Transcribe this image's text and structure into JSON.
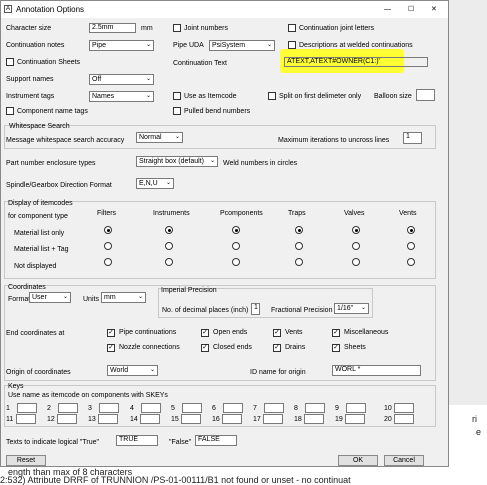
{
  "window": {
    "title": "Annotation Options",
    "minimize": "—",
    "maximize": "☐",
    "close": "✕"
  },
  "fields": {
    "character_size_label": "Character size",
    "character_size_value": "2.5mm",
    "character_size_unit": "mm",
    "joint_numbers": "Joint numbers",
    "continuation_joint_letters": "Continuation joint letters",
    "continuation_notes_label": "Continuation notes",
    "continuation_notes_value": "Pipe",
    "pipe_uda_label": "Pipe UDA",
    "pipe_uda_value": "PsiSystem",
    "descriptions_welded": "Descriptions at welded continuations",
    "continuation_sheets": "Continuation Sheets",
    "continuation_text_label": "Continuation Text",
    "continuation_text_value": "ATEXT,ATEXT#OWNER(C1:)'",
    "support_names_label": "Support names",
    "support_names_value": "Off",
    "instrument_tags_label": "Instrument tags",
    "instrument_tags_value": "Names",
    "use_as_itemcode": "Use as Itemcode",
    "split_first_delimiter": "Split on first delimeter only",
    "balloon_size": "Balloon size",
    "component_name_tags": "Component name tags",
    "pulled_bend_numbers": "Pulled bend numbers"
  },
  "whitespace": {
    "title": "Whitespace Search",
    "accuracy_label": "Message whitespace search accuracy",
    "accuracy_value": "Normal",
    "max_iter_label": "Maximum iterations to uncross lines",
    "max_iter_value": "1"
  },
  "partnum": {
    "label": "Part number enclosure types",
    "value": "Straight box (default)",
    "weld_label": "Weld numbers in circles"
  },
  "spindle": {
    "label": "Spindle/Gearbox Direction Format",
    "value": "E,N,U"
  },
  "itemcodes": {
    "title": "Display of itemcodes",
    "for_component_type": "for component type",
    "columns": [
      "Filters",
      "Instruments",
      "Pcomponents",
      "Traps",
      "Valves",
      "Vents"
    ],
    "rows": [
      "Material list only",
      "Material list + Tag",
      "Not displayed"
    ]
  },
  "coordinates": {
    "title": "Coordinates",
    "format_label": "Format",
    "format_value": "User",
    "units_label": "Units",
    "units_value": "mm",
    "imperial_title": "Imperial Precision",
    "decimal_label": "No. of decimal places (inch)",
    "decimal_value": "1",
    "fractional_label": "Fractional Precision",
    "fractional_value": "1/16\"",
    "end_label": "End coordinates at",
    "end_options": [
      "Pipe continuations",
      "Open ends",
      "Vents",
      "Miscellaneous",
      "Nozzle connections",
      "Closed ends",
      "Drains",
      "Sheets"
    ],
    "origin_label": "Origin of coordinates",
    "origin_value": "World",
    "id_name_label": "ID name for origin",
    "id_name_value": "WORL *"
  },
  "keys": {
    "title": "Keys",
    "subtitle": "Use name as itemcode on components with SKEYs",
    "numbers": [
      "1",
      "2",
      "3",
      "4",
      "5",
      "6",
      "7",
      "8",
      "9",
      "10",
      "11",
      "12",
      "13",
      "14",
      "15",
      "16",
      "17",
      "18",
      "19",
      "20"
    ]
  },
  "logical": {
    "label": "Texts to indicate logical \"True\"",
    "true_value": "TRUE",
    "false_label": "\"False\"",
    "false_value": "FALSE"
  },
  "buttons": {
    "reset": "Reset",
    "ok": "OK",
    "cancel": "Cancel"
  },
  "background": {
    "line1": "ength than max of 8 characters",
    "line2": "2:532) Attribute DRRF of TRUNNION /PS-01-00111/B1 not found or unset - no continuat",
    "side1": "ri",
    "side2": "e"
  },
  "colors": {
    "highlight": "#ffff33",
    "dialog_bg": "#f0f0f0"
  }
}
